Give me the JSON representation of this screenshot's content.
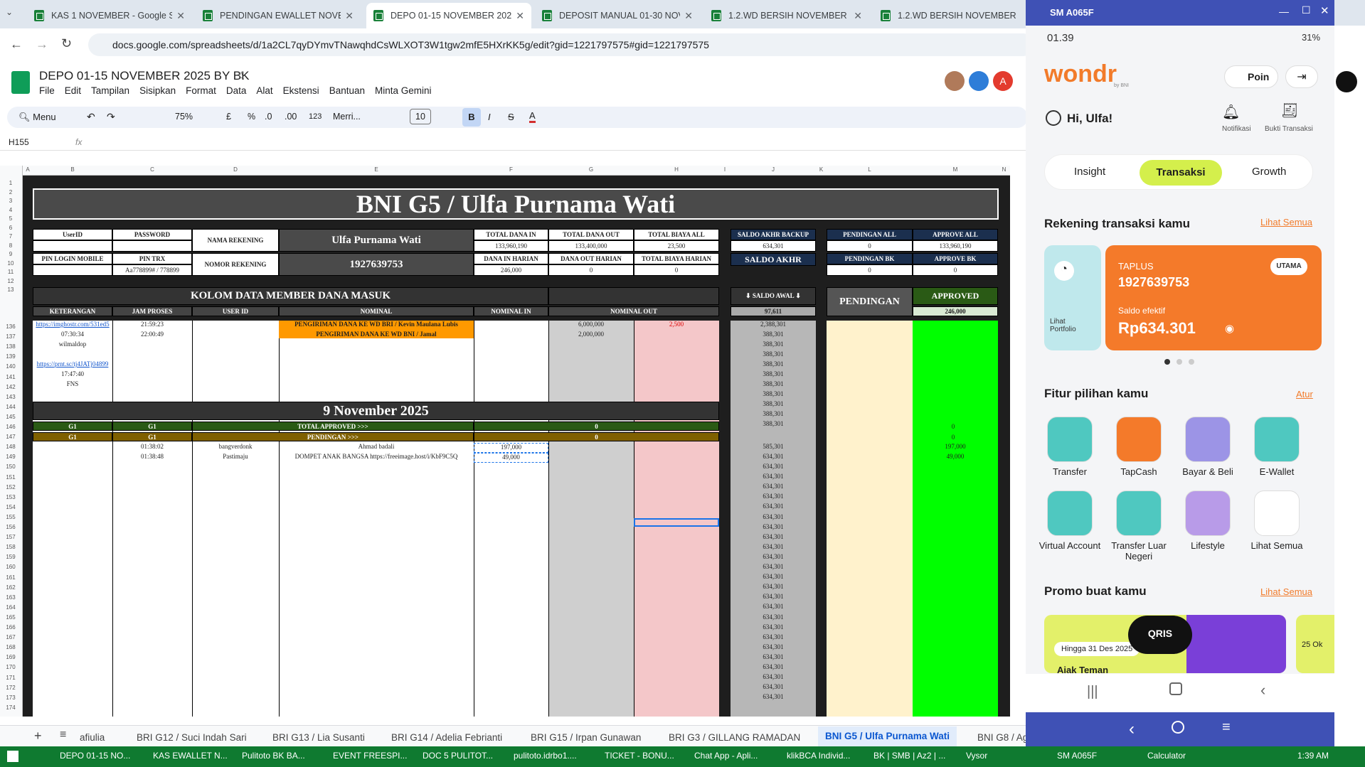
{
  "browser": {
    "tabs": [
      {
        "title": "KAS 1 NOVEMBER - Google Sp",
        "active": false
      },
      {
        "title": "PENDINGAN EWALLET NOVEM",
        "active": false
      },
      {
        "title": "DEPO 01-15 NOVEMBER 2025 I",
        "active": true
      },
      {
        "title": "DEPOSIT MANUAL 01-30 NOVE",
        "active": false
      },
      {
        "title": "1.2.WD BERSIH NOVEMBER - G",
        "active": false
      },
      {
        "title": "1.2.WD BERSIH NOVEMBER - G",
        "active": false
      }
    ],
    "url": "docs.google.com/spreadsheets/d/1a2CL7qyDYmvTNawqhdCsWLXOT3W1tgw2mfE5HXrKK5g/edit?gid=1221797575#gid=1221797575"
  },
  "sheets": {
    "title": "DEPO 01-15 NOVEMBER 2025 BY BK",
    "menu": [
      "File",
      "Edit",
      "Tampilan",
      "Sisipkan",
      "Format",
      "Data",
      "Alat",
      "Ekstensi",
      "Bantuan",
      "Minta Gemini"
    ],
    "toolbar": {
      "menu_label": "Menu",
      "zoom": "75%",
      "currency": "£",
      "percent": "%",
      "dec_less": ".0",
      "dec_more": ".00",
      "number": "123",
      "font": "Merri...",
      "font_size": "10",
      "bold": "B",
      "italic": "I",
      "strike": "S",
      "text_color": "A"
    },
    "name_box": "H155",
    "fx": "fx",
    "columns": [
      "A",
      "B",
      "C",
      "D",
      "E",
      "F",
      "G",
      "H",
      "I",
      "J",
      "K",
      "L",
      "M",
      "N"
    ],
    "rows_top": [
      "1",
      "2",
      "3",
      "4",
      "5",
      "6",
      "7",
      "8",
      "9",
      "10",
      "11",
      "12",
      "13"
    ],
    "rows_data": [
      "136",
      "137",
      "138",
      "139",
      "140",
      "141",
      "142",
      "143",
      "144",
      "145",
      "146",
      "147",
      "148",
      "149",
      "150",
      "151",
      "152",
      "153",
      "154",
      "155",
      "156",
      "157",
      "158",
      "159",
      "160",
      "161",
      "162",
      "163",
      "164",
      "165",
      "166",
      "167",
      "168",
      "169",
      "170",
      "171",
      "172",
      "173",
      "174"
    ],
    "sheet_header": "BNI G5 / Ulfa Purnama Wati",
    "labels": {
      "userid": "UserID",
      "password": "PASSWORD",
      "nama_rekening": "NAMA REKENING",
      "nama_value": "Ulfa Purnama Wati",
      "total_dana_in": "TOTAL DANA IN",
      "total_dana_out": "TOTAL DANA OUT",
      "total_biaya_all": "TOTAL BIAYA ALL",
      "saldo_akhir_backup": "SALDO AKHR BACKUP",
      "pendingan_all": "PENDINGAN ALL",
      "approve_all": "APPROVE ALL",
      "pin_login": "PIN LOGIN MOBILE",
      "pin_trx": "PIN TRX",
      "nomor_rekening": "NOMOR REKENING",
      "nomor_value": "1927639753",
      "dana_in_harian": "DANA IN HARIAN",
      "dana_out_harian": "DANA OUT HARIAN",
      "total_biaya_harian": "TOTAL BIAYA HARIAN",
      "saldo_akhir": "SALDO AKHR",
      "pendingan_bk": "PENDINGAN BK",
      "approve_bk": "APPROVE BK",
      "kolom": "KOLOM DATA MEMBER DANA MASUK",
      "saldo_awal": "⬇ SALDO AWAL ⬇",
      "pendingan": "PENDINGAN",
      "approved": "APPROVED",
      "keterangan": "KETERANGAN",
      "jam_proses": "JAM PROSES",
      "user_id": "USER ID",
      "nominal": "NOMINAL",
      "nominal_in": "NOMINAL IN",
      "nominal_out": "NOMINAL OUT"
    },
    "values": {
      "pin_trx": "Aa778899# / 778899",
      "total_dana_in": "133,960,190",
      "total_dana_out": "133,400,000",
      "total_biaya_all": "23,500",
      "saldo_backup": "634,301",
      "pendingan_all": "0",
      "approve_all": "133,960,190",
      "dana_in_harian": "246,000",
      "dana_out_harian": "0",
      "biaya_harian": "0",
      "pendingan_bk": "0",
      "approve_bk": "0",
      "saldo_awal": "97,611",
      "approved_total": "246,000"
    },
    "entries": [
      {
        "ket": "https://imghostr.com/531ed5",
        "jam": "21:59:23",
        "nominal": "PENGIRIMAN DANA KE WD BRI / Kevin Maulana Lubis",
        "out": "6,000,000",
        "biaya": "2,500",
        "saldo": "2,388,301"
      },
      {
        "ket": "07:30:34",
        "jam": "22:00:49",
        "nominal": "PENGIRIMAN DANA KE WD BNI / Jamal",
        "out": "2,000,000",
        "biaya": "",
        "saldo": "388,301"
      },
      {
        "ket": "wilmaldop",
        "jam": "",
        "nominal": "",
        "out": "",
        "biaya": "",
        "saldo": "388,301"
      },
      {
        "ket": "",
        "jam": "",
        "nominal": "",
        "out": "",
        "biaya": "",
        "saldo": "388,301"
      },
      {
        "ket": "https://prnt.sc/tj4JATj04899",
        "jam": "",
        "nominal": "",
        "out": "",
        "biaya": "",
        "saldo": "388,301"
      },
      {
        "ket": "17:47:40",
        "jam": "",
        "nominal": "",
        "out": "",
        "biaya": "",
        "saldo": "388,301"
      },
      {
        "ket": "FNS",
        "jam": "",
        "nominal": "",
        "out": "",
        "biaya": "",
        "saldo": "388,301"
      }
    ],
    "date_header": "9 November 2025",
    "g1_rows": [
      {
        "a": "G1",
        "b": "G1",
        "label": "TOTAL APPROVED >>>",
        "val": "0",
        "m": "0"
      },
      {
        "a": "G1",
        "b": "G1",
        "label": "PENDINGAN >>>",
        "val": "0",
        "m": "0"
      }
    ],
    "deposits": [
      {
        "jam": "01:38:02",
        "user": "bangverdonk",
        "nominal": "Ahmad badali",
        "in": "197,000",
        "saldo": "585,301",
        "approved": "197,000"
      },
      {
        "jam": "01:38:48",
        "user": "Pastimaju",
        "nominal": "DOMPET ANAK BANGSA https://freeimage.host/i/KbF9C5Q",
        "in": "49,000",
        "saldo": "634,301",
        "approved": "49,000"
      }
    ],
    "repeat_saldo": "634,301",
    "sheet_tabs": [
      "afiulia",
      "BRI G12 / Suci Indah Sari",
      "BRI G13 / Lia Susanti",
      "BRI G14 / Adelia Febrianti",
      "BRI G15 / Irpan Gunawan",
      "BRI G3 / GILLANG RAMADAN",
      "BNI G5 / Ulfa Purnama Wati",
      "BNI G8 / Ag"
    ]
  },
  "phone": {
    "window_title": "SM A065F",
    "time": "01.39",
    "battery": "31%",
    "brand": "wondr",
    "brand_sub": "by BNI",
    "poin": "Poin",
    "greeting": "Hi, Ulfa!",
    "notif": "Notifikasi",
    "bukti": "Bukti Transaksi",
    "tabs": [
      "Insight",
      "Transaksi",
      "Growth"
    ],
    "rekening_title": "Rekening transaksi kamu",
    "lihat_semua": "Lihat Semua",
    "lihat_portfolio": "Lihat Portfolio",
    "card": {
      "type": "TAPLUS",
      "number": "1927639753",
      "badge": "UTAMA",
      "saldo_label": "Saldo efektif",
      "saldo": "Rp634.301"
    },
    "fitur_title": "Fitur pilihan kamu",
    "atur": "Atur",
    "features": [
      {
        "label": "Transfer",
        "icon": "send-icon",
        "color": "#4fc8c0"
      },
      {
        "label": "TapCash",
        "icon": "tapcash-icon",
        "color": "#f47a2a"
      },
      {
        "label": "Bayar & Beli",
        "icon": "bill-icon",
        "color": "#9c94e6"
      },
      {
        "label": "E-Wallet",
        "icon": "wallet-icon",
        "color": "#4fc8c0"
      },
      {
        "label": "Virtual Account",
        "icon": "va-icon",
        "color": "#4fc8c0"
      },
      {
        "label": "Transfer Luar Negeri",
        "icon": "globe-icon",
        "color": "#4fc8c0"
      },
      {
        "label": "Lifestyle",
        "icon": "bag-icon",
        "color": "#b89be8"
      },
      {
        "label": "Lihat Semua",
        "icon": "grid-icon",
        "color": "#ffffff"
      }
    ],
    "promo_title": "Promo buat kamu",
    "promo_lihat": "Lihat Semua",
    "promo": {
      "date": "Hingga 31 Des 2025",
      "text": "Ajak Teman",
      "date2": "25 Ok",
      "qris": "QRIS"
    }
  },
  "taskbar": {
    "items": [
      "DEPO 01-15 NO...",
      "KAS EWALLET N...",
      "Pulitoto BK BA...",
      "EVENT FREESPI...",
      "DOC 5 PULITOT...",
      "pulitoto.idrbo1....",
      "TICKET - BONU...",
      "Chat App - Apli...",
      "klikBCA Individ...",
      "BK | SMB | Az2 | ...",
      "Vysor",
      "SM A065F",
      "Calculator"
    ],
    "clock": "1:39 AM"
  }
}
